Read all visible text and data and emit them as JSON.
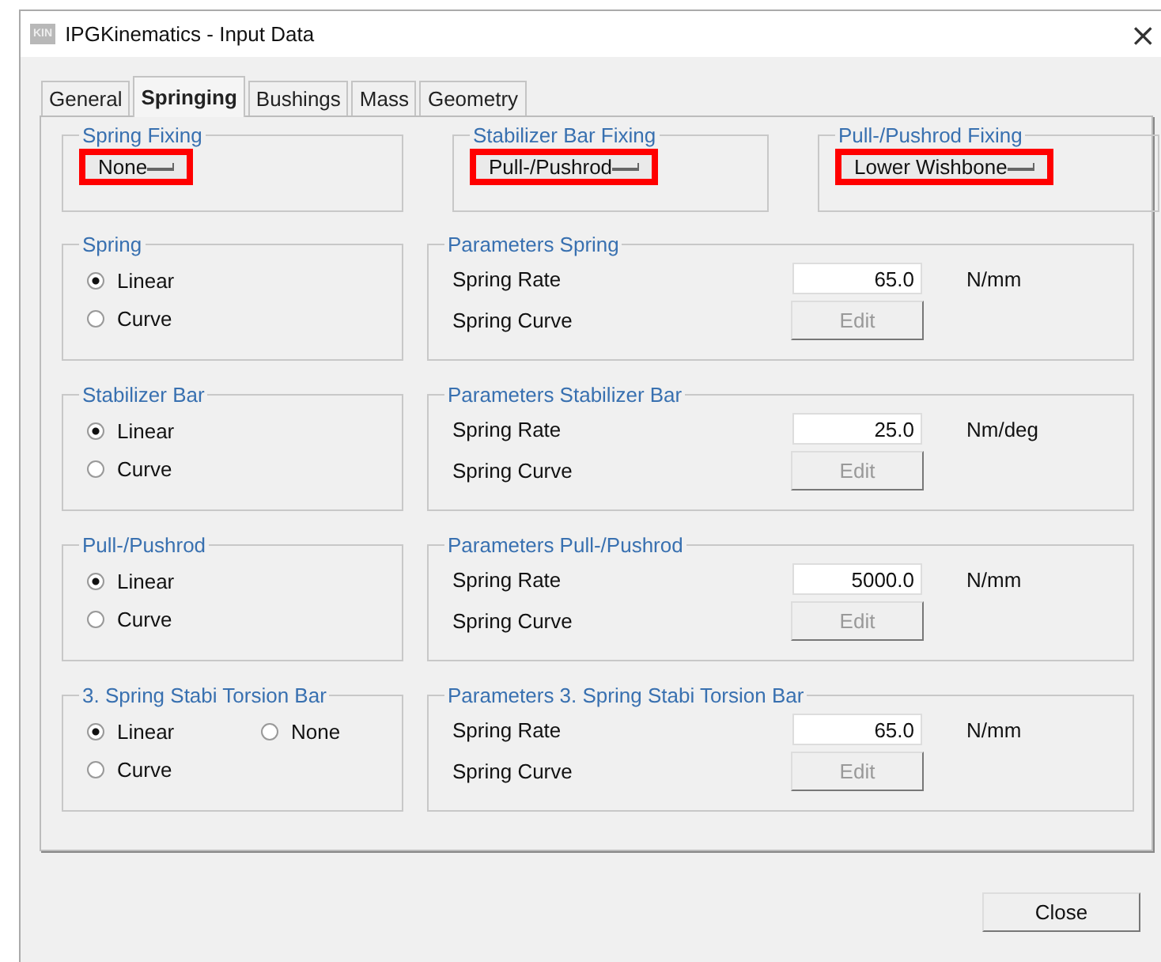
{
  "window": {
    "title": "IPGKinematics - Input Data",
    "app_icon": "KIN",
    "close": "×"
  },
  "tabs": [
    {
      "label": "General",
      "selected": false
    },
    {
      "label": "Springing",
      "selected": true
    },
    {
      "label": "Bushings",
      "selected": false
    },
    {
      "label": "Mass",
      "selected": false
    },
    {
      "label": "Geometry",
      "selected": false
    }
  ],
  "fixings": [
    {
      "title": "Spring Fixing",
      "value": "None",
      "highlighted": true
    },
    {
      "title": "Stabilizer Bar Fixing",
      "value": "Pull-/Pushrod",
      "highlighted": true
    },
    {
      "title": "Pull-/Pushrod Fixing",
      "value": "Lower Wishbone",
      "highlighted": true
    }
  ],
  "sections": [
    {
      "type": {
        "title": "Spring",
        "options": [
          {
            "label": "Linear",
            "selected": true
          },
          {
            "label": "Curve",
            "selected": false
          }
        ]
      },
      "parameters": {
        "title": "Parameters Spring",
        "rate_label": "Spring Rate",
        "rate": "65.0",
        "unit": "N/mm",
        "curve_label": "Spring Curve",
        "button": "Edit",
        "disabled": true
      }
    },
    {
      "type": {
        "title": "Stabilizer Bar",
        "options": [
          {
            "label": "Linear",
            "selected": true
          },
          {
            "label": "Curve",
            "selected": false
          }
        ]
      },
      "parameters": {
        "title": "Parameters Stabilizer Bar",
        "rate_label": "Spring Rate",
        "rate": "25.0",
        "unit": "Nm/deg",
        "curve_label": "Spring Curve",
        "button": "Edit",
        "disabled": true
      }
    },
    {
      "type": {
        "title": "Pull-/Pushrod",
        "options": [
          {
            "label": "Linear",
            "selected": true
          },
          {
            "label": "Curve",
            "selected": false
          }
        ]
      },
      "parameters": {
        "title": "Parameters Pull-/Pushrod",
        "rate_label": "Spring Rate",
        "rate": "5000.0",
        "unit": "N/mm",
        "curve_label": "Spring Curve",
        "button": "Edit",
        "disabled": true
      }
    },
    {
      "type": {
        "title": "3. Spring Stabi Torsion Bar",
        "options": [
          {
            "label": "Linear",
            "selected": true
          },
          {
            "label": "None",
            "selected": false
          },
          {
            "label": "Curve",
            "selected": false
          }
        ]
      },
      "parameters": {
        "title": "Parameters 3. Spring Stabi Torsion Bar",
        "rate_label": "Spring Rate",
        "rate": "65.0",
        "unit": "N/mm",
        "curve_label": "Spring Curve",
        "button": "Edit",
        "disabled": true
      }
    }
  ],
  "buttons": [
    "Close"
  ]
}
